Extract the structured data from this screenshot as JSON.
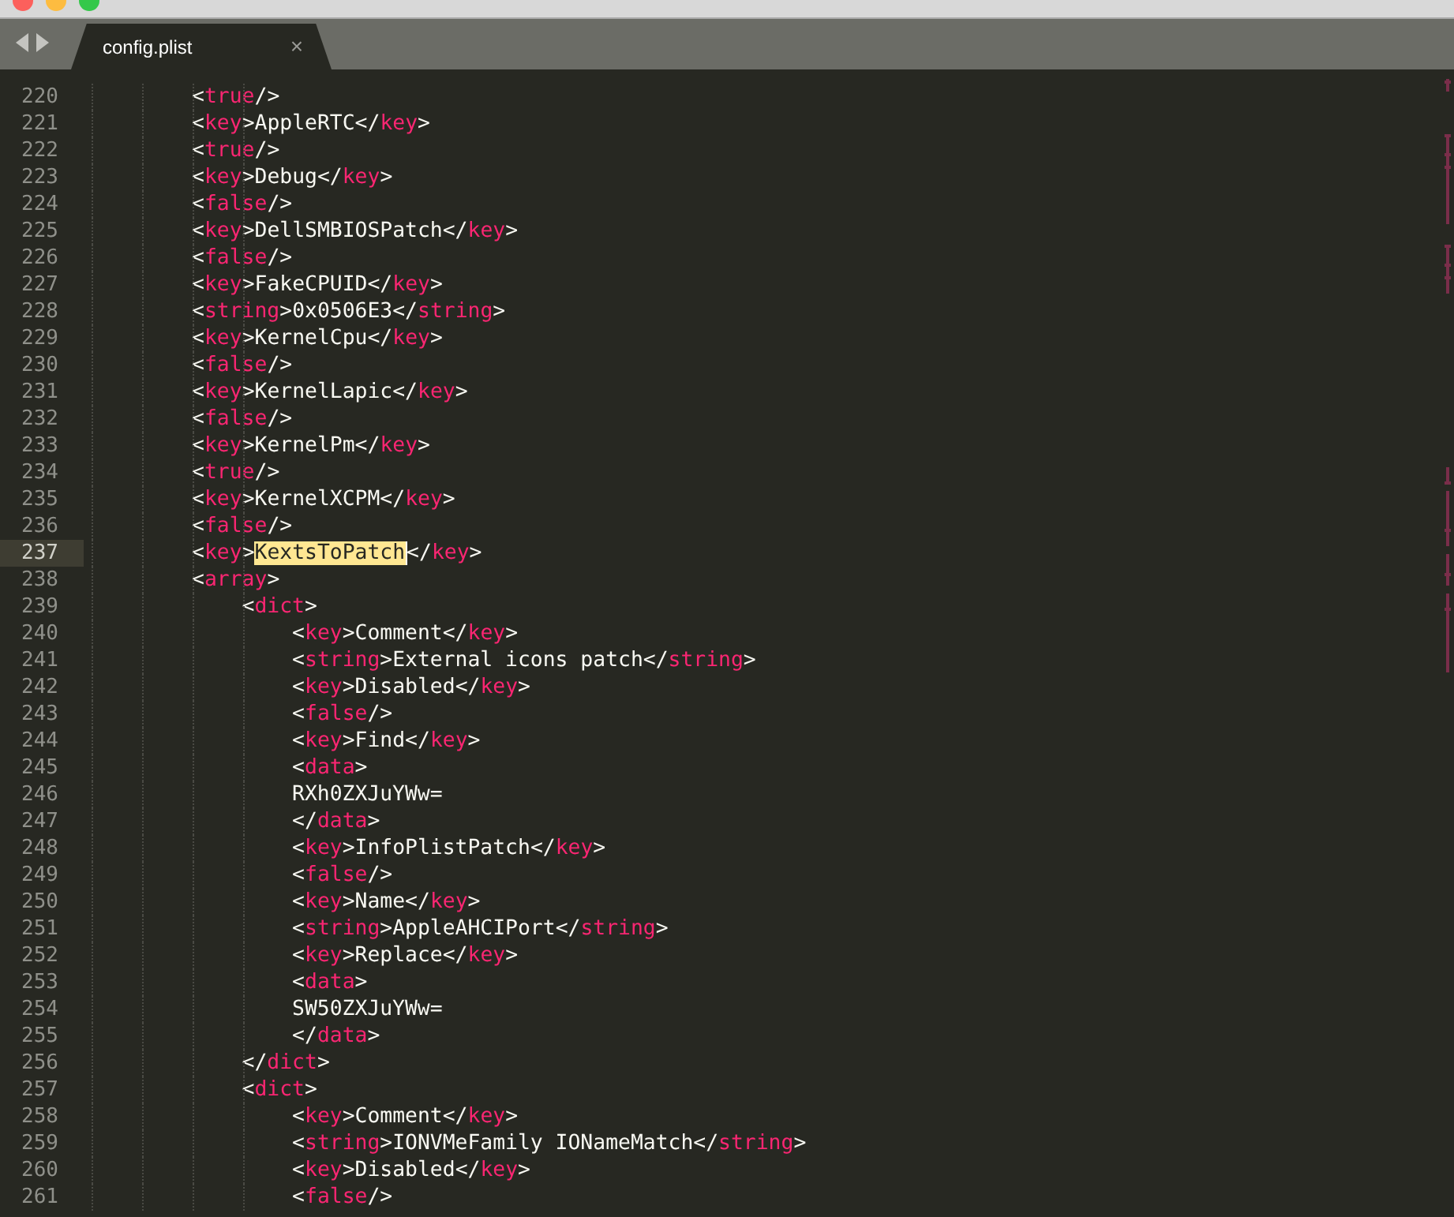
{
  "tabs": [
    {
      "label": "config.plist",
      "close": "×",
      "selected": true
    }
  ],
  "editor": {
    "lines": [
      {
        "number": "220",
        "code": "        <true/>",
        "current": false
      },
      {
        "number": "221",
        "code": "        <key>AppleRTC</key>",
        "current": false
      },
      {
        "number": "222",
        "code": "        <true/>",
        "current": false
      },
      {
        "number": "223",
        "code": "        <key>Debug</key>",
        "current": false
      },
      {
        "number": "224",
        "code": "        <false/>",
        "current": false
      },
      {
        "number": "225",
        "code": "        <key>DellSMBIOSPatch</key>",
        "current": false
      },
      {
        "number": "226",
        "code": "        <false/>",
        "current": false
      },
      {
        "number": "227",
        "code": "        <key>FakeCPUID</key>",
        "current": false
      },
      {
        "number": "228",
        "code": "        <string>0x0506E3</string>",
        "current": false
      },
      {
        "number": "229",
        "code": "        <key>KernelCpu</key>",
        "current": false
      },
      {
        "number": "230",
        "code": "        <false/>",
        "current": false
      },
      {
        "number": "231",
        "code": "        <key>KernelLapic</key>",
        "current": false
      },
      {
        "number": "232",
        "code": "        <false/>",
        "current": false
      },
      {
        "number": "233",
        "code": "        <key>KernelPm</key>",
        "current": false
      },
      {
        "number": "234",
        "code": "        <true/>",
        "current": false
      },
      {
        "number": "235",
        "code": "        <key>KernelXCPM</key>",
        "current": false
      },
      {
        "number": "236",
        "code": "        <false/>",
        "current": false
      },
      {
        "number": "237",
        "parts": [
          {
            "text": "        <key>",
            "found": false
          },
          {
            "text": "KextsToPatch",
            "found": true
          },
          {
            "text": "</key>",
            "found": false
          }
        ],
        "current": true
      },
      {
        "number": "238",
        "code": "        <array>",
        "current": false
      },
      {
        "number": "239",
        "code": "            <dict>",
        "current": false
      },
      {
        "number": "240",
        "code": "                <key>Comment</key>",
        "current": false
      },
      {
        "number": "241",
        "code": "                <string>External icons patch</string>",
        "current": false
      },
      {
        "number": "242",
        "code": "                <key>Disabled</key>",
        "current": false
      },
      {
        "number": "243",
        "code": "                <false/>",
        "current": false
      },
      {
        "number": "244",
        "code": "                <key>Find</key>",
        "current": false
      },
      {
        "number": "245",
        "code": "                <data>",
        "current": false
      },
      {
        "number": "246",
        "code": "                RXh0ZXJuYWw=",
        "current": false
      },
      {
        "number": "247",
        "code": "                </data>",
        "current": false
      },
      {
        "number": "248",
        "code": "                <key>InfoPlistPatch</key>",
        "current": false
      },
      {
        "number": "249",
        "code": "                <false/>",
        "current": false
      },
      {
        "number": "250",
        "code": "                <key>Name</key>",
        "current": false
      },
      {
        "number": "251",
        "code": "                <string>AppleAHCIPort</string>",
        "current": false
      },
      {
        "number": "252",
        "code": "                <key>Replace</key>",
        "current": false
      },
      {
        "number": "253",
        "code": "                <data>",
        "current": false
      },
      {
        "number": "254",
        "code": "                SW50ZXJuYWw=",
        "current": false
      },
      {
        "number": "255",
        "code": "                </data>",
        "current": false
      },
      {
        "number": "256",
        "code": "            </dict>",
        "current": false
      },
      {
        "number": "257",
        "code": "            <dict>",
        "current": false
      },
      {
        "number": "258",
        "code": "                <key>Comment</key>",
        "current": false
      },
      {
        "number": "259",
        "code": "                <string>IONVMeFamily IONameMatch</string>",
        "current": false
      },
      {
        "number": "260",
        "code": "                <key>Disabled</key>",
        "current": false
      },
      {
        "number": "261",
        "code": "                <false/>",
        "current": false
      }
    ]
  }
}
